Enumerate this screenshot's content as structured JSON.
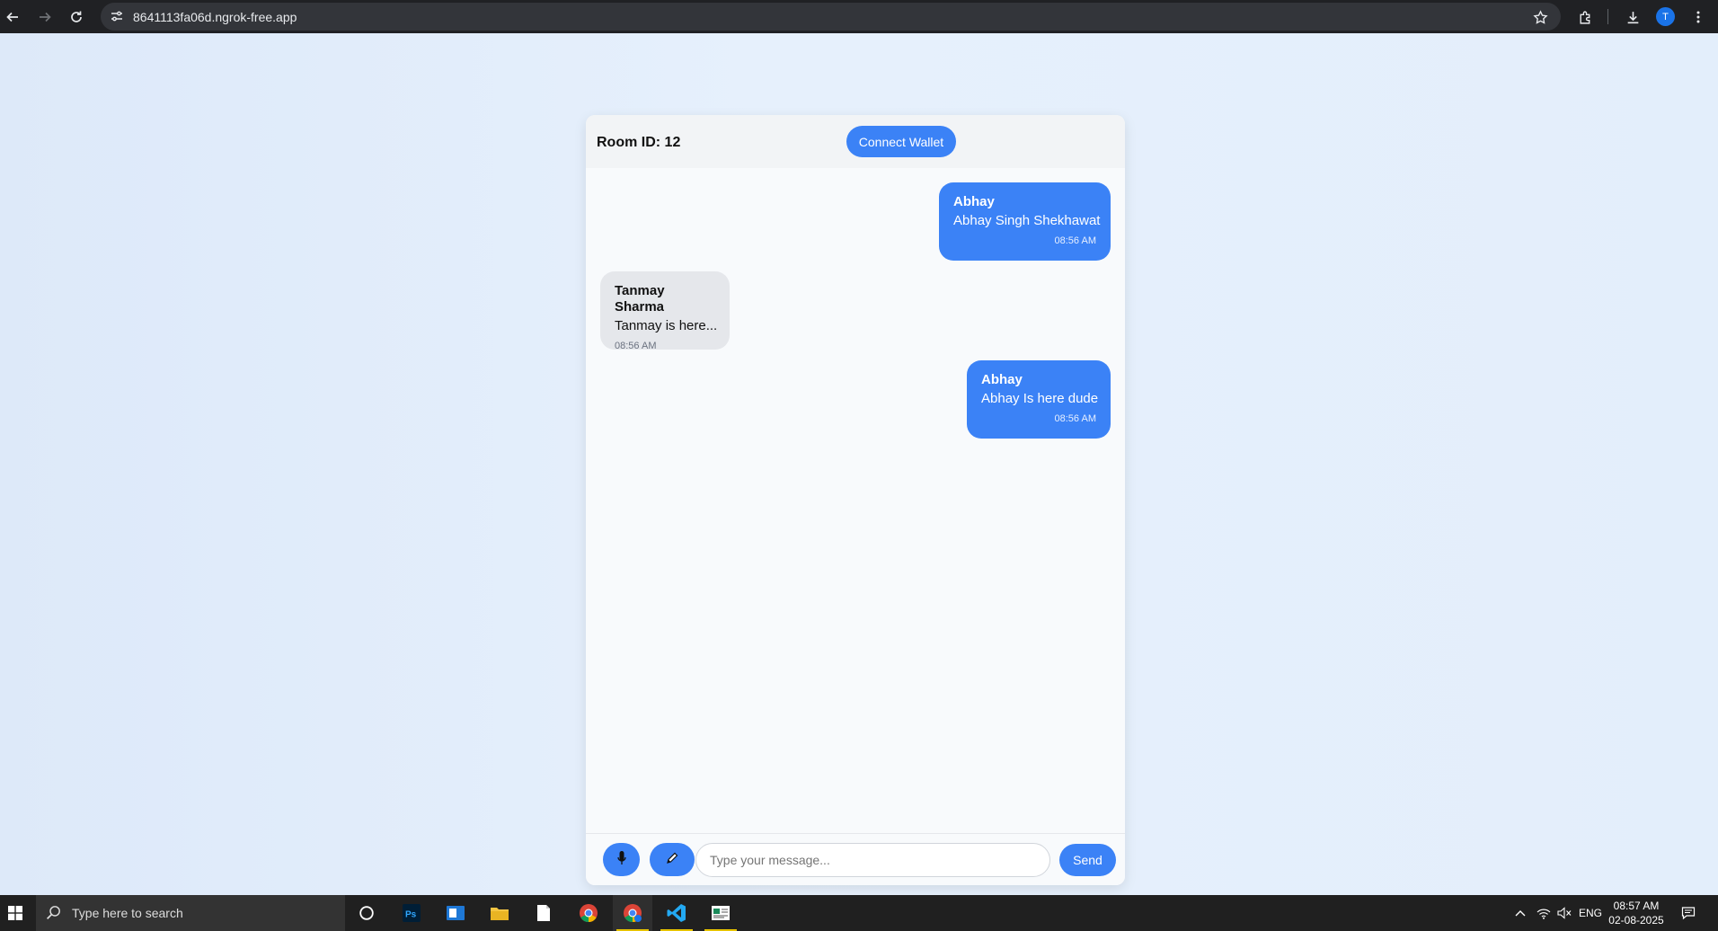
{
  "browser": {
    "url": "8641113fa06d.ngrok-free.app",
    "profile_initial": "T"
  },
  "header": {
    "room_label": "Room ID: 12",
    "connect_wallet_label": "Connect Wallet"
  },
  "messages": [
    {
      "sender": "Abhay",
      "text": "Abhay Singh Shekhawat",
      "time": "08:56 AM",
      "own": true
    },
    {
      "sender": "Tanmay Sharma",
      "text": "Tanmay is here...",
      "time": "08:56 AM",
      "own": false
    },
    {
      "sender": "Abhay",
      "text": "Abhay Is here dude",
      "time": "08:56 AM",
      "own": true
    }
  ],
  "composer": {
    "input_value": "",
    "input_placeholder": "Type your message...",
    "send_label": "Send",
    "mic_icon": "mic-icon",
    "attach_icon": "pen-icon"
  },
  "taskbar": {
    "search_placeholder": "Type here to search",
    "language": "ENG",
    "time": "08:57 AM",
    "date": "02-08-2025"
  },
  "colors": {
    "accent": "#3b82f6",
    "incoming_bubble": "#e5e7eb",
    "page_bg": "#e3edfa"
  }
}
